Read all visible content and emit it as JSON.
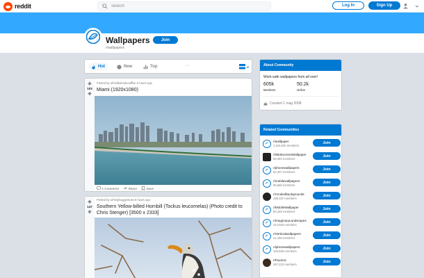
{
  "header": {
    "logo_text": "reddit",
    "search_placeholder": "Search",
    "login_label": "Log In",
    "signup_label": "Sign Up"
  },
  "subreddit": {
    "title": "Wallpapers",
    "name": "r/wallpapers",
    "join_label": "Join",
    "banner_color": "#33a8ff"
  },
  "sort": {
    "tabs": [
      "Hot",
      "New",
      "Top"
    ],
    "active": "Hot",
    "more": "···"
  },
  "posts": [
    {
      "meta": "Posted by u/heidisiirodunuffkin 3 hours ago",
      "votes": "103",
      "title": "Miami (1920x1080)",
      "comments": "1 Comment",
      "share": "Share",
      "save": "Save",
      "more": "···"
    },
    {
      "meta": "Posted by u/HelpSuggeniuss 8 hours ago",
      "votes": "147",
      "title": "Southern Yellow-billed Hornbill (Tockus leucomelas) (Photo credit to Chris Stenger) [3500 x 2333]"
    }
  ],
  "about": {
    "heading": "About Community",
    "description": "Work-safe wallpapers from all over!",
    "members_value": "605k",
    "members_label": "Members",
    "online_value": "50.2k",
    "online_label": "Online",
    "created": "Created 1 mag 2008"
  },
  "related": {
    "heading": "Related Communities",
    "join_label": "Join",
    "items": [
      {
        "name": "r/wallpaper",
        "members": "1,619,840 members"
      },
      {
        "name": "r/WidescreenWallpaper",
        "members": "58,482 members"
      },
      {
        "name": "r/phonewallpapers",
        "members": "62,337 members"
      },
      {
        "name": "r/mobilewallpapers",
        "members": "55,965 members"
      },
      {
        "name": "r/Amoledbackgrounds",
        "members": "188,337 members"
      },
      {
        "name": "r/MobileWallpaper",
        "members": "80,348 members"
      },
      {
        "name": "r/ImaginaryLandscapes",
        "members": "314,593 members"
      },
      {
        "name": "r/Verticalwallpapers",
        "members": "41,195 members"
      },
      {
        "name": "r/iphonewallpapers",
        "members": "153,596 members"
      },
      {
        "name": "r/PixelArt",
        "members": "267,223 members"
      }
    ]
  },
  "colors": {
    "accent": "#0079d3",
    "brand": "#ff4500",
    "background": "#dae0e6"
  }
}
